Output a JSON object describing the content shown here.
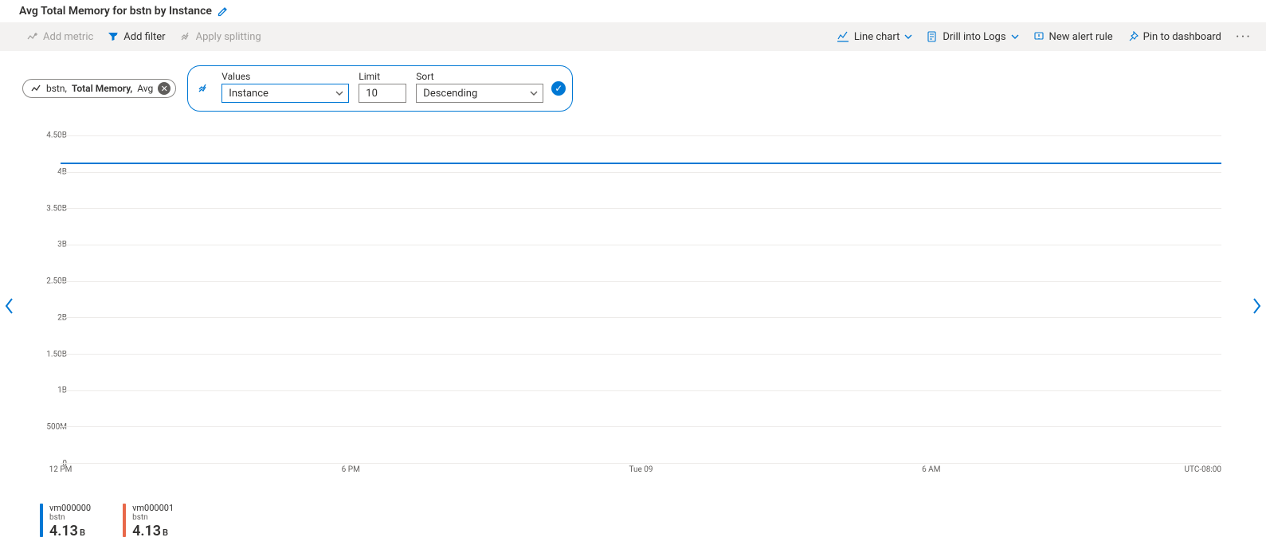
{
  "header": {
    "title": "Avg Total Memory for bstn by Instance"
  },
  "toolbar": {
    "add_metric": "Add metric",
    "add_filter": "Add filter",
    "apply_splitting": "Apply splitting",
    "line_chart": "Line chart",
    "drill_logs": "Drill into Logs",
    "new_alert": "New alert rule",
    "pin": "Pin to dashboard"
  },
  "metric_pill": {
    "resource": "bstn,",
    "metric": "Total Memory,",
    "aggregation": "Avg"
  },
  "split": {
    "values_label": "Values",
    "values_value": "Instance",
    "limit_label": "Limit",
    "limit_value": "10",
    "sort_label": "Sort",
    "sort_value": "Descending"
  },
  "timezone": "UTC-08:00",
  "legend": [
    {
      "name": "vm000000",
      "resource": "bstn",
      "value": "4.13",
      "unit": "B",
      "color": "#0078d4"
    },
    {
      "name": "vm000001",
      "resource": "bstn",
      "value": "4.13",
      "unit": "B",
      "color": "#e8684a"
    }
  ],
  "chart_data": {
    "type": "line",
    "title": "Avg Total Memory for bstn by Instance",
    "xlabel": "",
    "ylabel": "",
    "ylim": [
      0,
      4500000000
    ],
    "y_ticks": [
      {
        "v": 0,
        "label": "0"
      },
      {
        "v": 500000000,
        "label": "500M"
      },
      {
        "v": 1000000000,
        "label": "1B"
      },
      {
        "v": 1500000000,
        "label": "1.50B"
      },
      {
        "v": 2000000000,
        "label": "2B"
      },
      {
        "v": 2500000000,
        "label": "2.50B"
      },
      {
        "v": 3000000000,
        "label": "3B"
      },
      {
        "v": 3500000000,
        "label": "3.50B"
      },
      {
        "v": 4000000000,
        "label": "4B"
      },
      {
        "v": 4500000000,
        "label": "4.50B"
      }
    ],
    "x_ticks": [
      {
        "pos": 0.0,
        "label": "12 PM"
      },
      {
        "pos": 0.25,
        "label": "6 PM"
      },
      {
        "pos": 0.5,
        "label": "Tue 09"
      },
      {
        "pos": 0.75,
        "label": "6 AM"
      }
    ],
    "series": [
      {
        "name": "vm000000",
        "color": "#0078d4",
        "constant_value": 4130000000
      },
      {
        "name": "vm000001",
        "color": "#e8684a",
        "constant_value": 4130000000
      }
    ]
  }
}
